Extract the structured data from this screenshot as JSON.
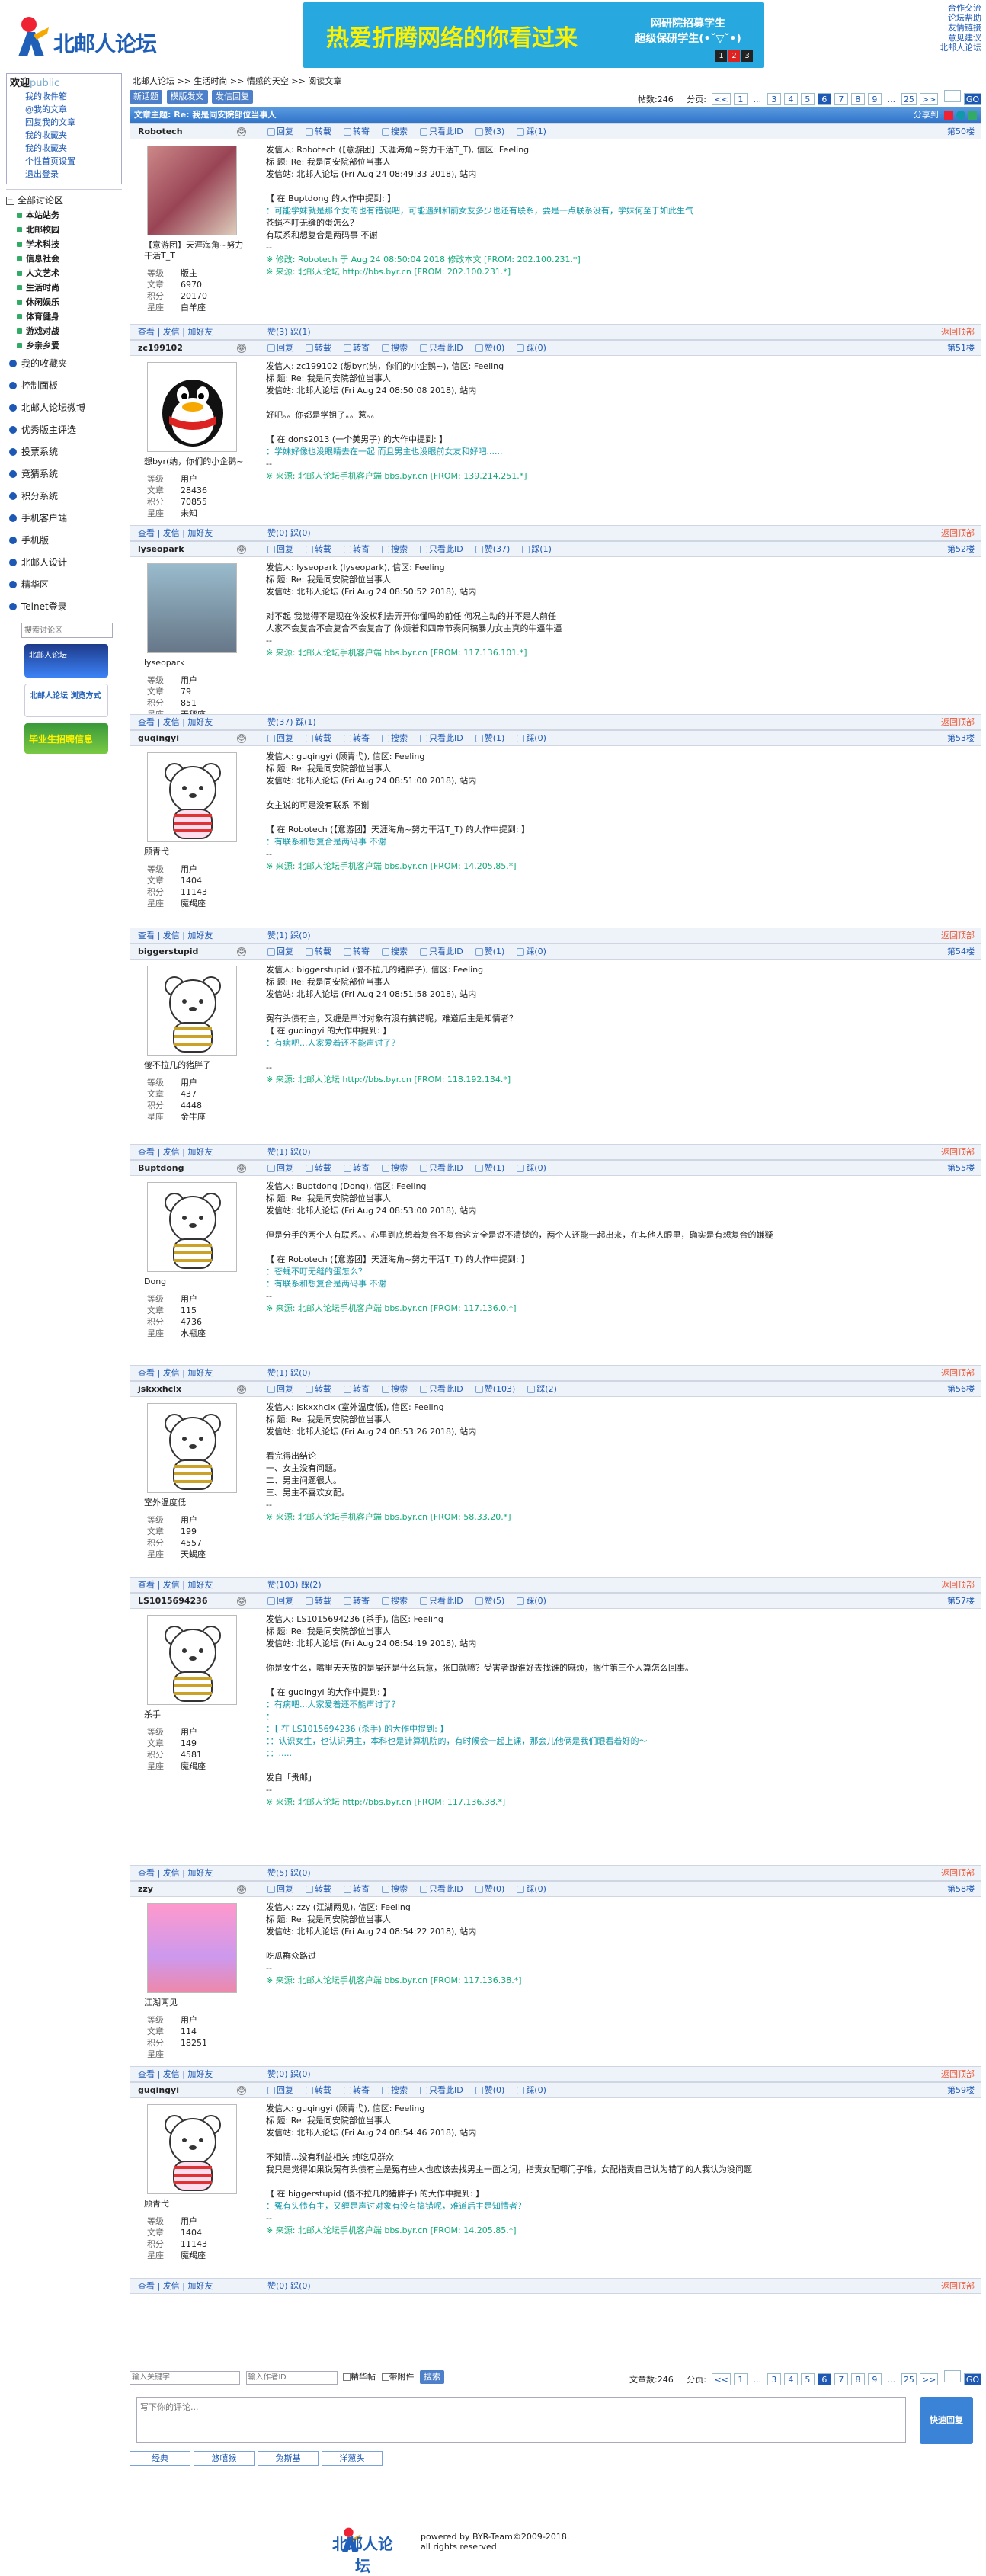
{
  "header": {
    "logo_text": "北邮人论坛",
    "banner_main": "热爱折腾网络的你看过来",
    "banner_sub1": "网研院招募学生",
    "banner_sub2": "超级保研学生(•ˇ▽ˇ•)",
    "banner_dots": [
      "1",
      "2",
      "3"
    ],
    "links": [
      "合作交流",
      "论坛帮助",
      "友情链接",
      "意见建议",
      "北邮人论坛"
    ]
  },
  "sidebar": {
    "welcome": "欢迎",
    "user": "public",
    "mine": [
      "我的收件箱",
      "@我的文章",
      "回复我的文章",
      "我的收藏夹",
      "我的收藏夹",
      "个性首页设置",
      "退出登录"
    ],
    "all_boards": "全部讨论区",
    "boards": [
      "本站站务",
      "北邮校园",
      "学术科技",
      "信息社会",
      "人文艺术",
      "生活时尚",
      "休闲娱乐",
      "体育健身",
      "游戏对战",
      "乡亲乡爱"
    ],
    "nav": [
      "我的收藏夹",
      "控制面板",
      "北邮人论坛微博",
      "优秀版主评选",
      "投票系统",
      "竞猜系统",
      "积分系统",
      "手机客户端",
      "手机版",
      "北邮人设计",
      "精华区",
      "Telnet登录"
    ],
    "search_placeholder": "搜索讨论区",
    "badge1": "北邮人论坛",
    "badge2": "北邮人论坛 浏览方式",
    "badge3": "毕业生招聘信息"
  },
  "crumb": "北邮人论坛 >> 生活时尚 >> 情感的天空 >> 阅读文章",
  "toolbar": {
    "new": "新话题",
    "mode": "模版发文",
    "reply": "发信回复",
    "count": "帖数:246",
    "pages_label": "分页:",
    "pages": [
      "<<",
      "1",
      "...",
      "3",
      "4",
      "5",
      "6",
      "7",
      "8",
      "9",
      "...",
      "25",
      ">>"
    ],
    "go": "GO"
  },
  "title": "文章主题: Re: 我是同安院部位当事人",
  "share": "分享到:",
  "acts": [
    "回复",
    "转载",
    "转寄",
    "搜索",
    "只看此ID",
    "赞(0)",
    "踩(0)"
  ],
  "posts": [
    {
      "user": "Robotech",
      "floor": "第50楼",
      "level": "版主",
      "posts": "6970",
      "score": "20170",
      "star": "白羊座",
      "sig": "【意游团】天涯海角~努力干活T_T",
      "lines": [
        "发信人: Robotech (【意游团】天涯海角~努力干活T_T), 信区: Feeling",
        "标  题: Re: 我是同安院部位当事人",
        "发信站: 北邮人论坛 (Fri Aug 24 08:49:33 2018), 站内",
        "",
        "【 在 Buptdong 的大作中提到: 】",
        "：可能学妹就是那个女的也有错误吧，可能遇到和前女友多少也还有联系，要是一点联系没有，学妹何至于如此生气",
        "苍蝇不叮无缝的蛋怎么？",
        "有联系和想复合是两码事 不谢",
        "--",
        "※ 修改: Robotech 于 Aug 24 08:50:04 2018 修改本文 [FROM: 202.100.231.*]",
        "※ 来源: 北邮人论坛 http://bbs.byr.cn [FROM: 202.100.231.*]"
      ],
      "votes": [
        "赞(3)",
        "踩(1)"
      ]
    },
    {
      "user": "zc199102",
      "floor": "第51楼",
      "level": "用户",
      "posts": "28436",
      "score": "70855",
      "star": "未知",
      "sig": "想byr(纳，你们的小企鹅~",
      "lines": [
        "发信人: zc199102 (想byr(纳，你们的小企鹅~), 信区: Feeling",
        "标  题: Re: 我是同安院部位当事人",
        "发信站: 北邮人论坛 (Fri Aug 24 08:50:08 2018), 站内",
        "",
        "好吧。。你都是学姐了。。惹。。",
        "",
        "【 在 dons2013 (一个美男子) 的大作中提到: 】",
        "：学妹好像也没眼睛去在一起 而且男主也没眼前女友和好吧......",
        "--",
        "※ 来源: 北邮人论坛手机客户端 bbs.byr.cn [FROM: 139.214.251.*]"
      ],
      "votes": [
        "赞(0)",
        "踩(0)"
      ]
    },
    {
      "user": "lyseopark",
      "floor": "第52楼",
      "level": "用户",
      "posts": "79",
      "score": "851",
      "star": "天秤座",
      "sig": "lyseopark",
      "lines": [
        "发信人: lyseopark (lyseopark), 信区: Feeling",
        "标  题: Re: 我是同安院部位当事人",
        "发信站: 北邮人论坛 (Fri Aug 24 08:50:52 2018), 站内",
        "",
        "对不起 我觉得不是现在你没权利去弄开你懂吗的前任 何况主动的并不是人前任",
        "人家不会复合不会复合不会复合了 你烦着和四帝节奏同稿暴力女主真的牛逼牛逼",
        "--",
        "※ 来源: 北邮人论坛手机客户端 bbs.byr.cn [FROM: 117.136.101.*]"
      ],
      "votes": [
        "赞(37)",
        "踩(1)"
      ]
    },
    {
      "user": "guqingyi",
      "floor": "第53楼",
      "level": "用户",
      "posts": "1404",
      "score": "11143",
      "star": "魔羯座",
      "sig": "顾青弋",
      "lines": [
        "发信人: guqingyi (顾青弋), 信区: Feeling",
        "标  题: Re: 我是同安院部位当事人",
        "发信站: 北邮人论坛 (Fri Aug 24 08:51:00 2018), 站内",
        "",
        "女主说的可是没有联系 不谢",
        "",
        "【 在 Robotech (【意游团】天涯海角~努力干活T_T) 的大作中提到: 】",
        "：有联系和想复合是两码事 不谢",
        "--",
        "※ 来源: 北邮人论坛手机客户端 bbs.byr.cn [FROM: 14.205.85.*]"
      ],
      "votes": [
        "赞(1)",
        "踩(0)"
      ]
    },
    {
      "user": "biggerstupid",
      "floor": "第54楼",
      "level": "用户",
      "posts": "437",
      "score": "4448",
      "star": "金牛座",
      "sig": "傻不拉几的猪胖子",
      "lines": [
        "发信人: biggerstupid (傻不拉几的猪胖子), 信区: Feeling",
        "标  题: Re: 我是同安院部位当事人",
        "发信站: 北邮人论坛 (Fri Aug 24 08:51:58 2018), 站内",
        "",
        "冤有头债有主，又缠是声讨对象有没有搞错呢，难道后主是知情者？",
        "【 在 guqingyi 的大作中提到: 】",
        "：有病吧...人家爱着还不能声讨了？",
        "",
        "--",
        "※ 来源: 北邮人论坛 http://bbs.byr.cn [FROM: 118.192.134.*]"
      ],
      "votes": [
        "赞(1)",
        "踩(0)"
      ]
    },
    {
      "user": "Buptdong",
      "floor": "第55楼",
      "level": "用户",
      "posts": "115",
      "score": "4736",
      "star": "水瓶座",
      "sig": "Dong",
      "lines": [
        "发信人: Buptdong (Dong), 信区: Feeling",
        "标  题: Re: 我是同安院部位当事人",
        "发信站: 北邮人论坛 (Fri Aug 24 08:53:00 2018), 站内",
        "",
        "但是分手的两个人有联系。。心里到底想着复合不复合这完全是说不清楚的，两个人还能一起出来，在其他人眼里，确实是有想复合的嫌疑",
        "",
        "【 在 Robotech (【意游团】天涯海角~努力干活T_T) 的大作中提到: 】",
        "：苍蝇不叮无缝的蛋怎么？",
        "：有联系和想复合是两码事 不谢",
        "--",
        "※ 来源: 北邮人论坛手机客户端 bbs.byr.cn [FROM: 117.136.0.*]"
      ],
      "votes": [
        "赞(1)",
        "踩(0)"
      ]
    },
    {
      "user": "jskxxhclx",
      "floor": "第56楼",
      "level": "用户",
      "posts": "199",
      "score": "4557",
      "star": "天蝎座",
      "sig": "室外温度低",
      "lines": [
        "发信人: jskxxhclx (室外温度低), 信区: Feeling",
        "标  题: Re: 我是同安院部位当事人",
        "发信站: 北邮人论坛 (Fri Aug 24 08:53:26 2018), 站内",
        "",
        "看完得出结论",
        "一、女主没有问题。",
        "二、男主问题很大。",
        "三、男主不喜欢女配。",
        "--",
        "※ 来源: 北邮人论坛手机客户端 bbs.byr.cn [FROM: 58.33.20.*]"
      ],
      "votes": [
        "赞(103)",
        "踩(2)"
      ]
    },
    {
      "user": "LS1015694236",
      "floor": "第57楼",
      "level": "用户",
      "posts": "149",
      "score": "4581",
      "star": "魔羯座",
      "sig": "杀手",
      "lines": [
        "发信人: LS1015694236 (杀手), 信区: Feeling",
        "标  题: Re: 我是同安院部位当事人",
        "发信站: 北邮人论坛 (Fri Aug 24 08:54:19 2018), 站内",
        "",
        "你是女生么，嘴里天天放的是屎还是什么玩意，张口就喷？受害者跟谁好去找谁的麻烦，搁住第三个人算怎么回事。",
        "",
        "【 在 guqingyi 的大作中提到: 】",
        "：有病吧...人家爱着还不能声讨了？",
        "：",
        "：【 在 LS1015694236 (杀手) 的大作中提到: 】",
        "：：认识女生，也认识男主，本科也是计算机院的，有时候会一起上课，那会儿他俩是我们眼看着好的～",
        "：：.....",
        "",
        "发自「贵邮」",
        "--",
        "※ 来源: 北邮人论坛 http://bbs.byr.cn [FROM: 117.136.38.*]"
      ],
      "votes": [
        "赞(5)",
        "踩(0)"
      ]
    },
    {
      "user": "zzy",
      "floor": "第58楼",
      "level": "用户",
      "posts": "114",
      "score": "18251",
      "star": "",
      "sig": "江湖两见",
      "lines": [
        "发信人: zzy (江湖两见), 信区: Feeling",
        "标  题: Re: 我是同安院部位当事人",
        "发信站: 北邮人论坛 (Fri Aug 24 08:54:22 2018), 站内",
        "",
        "吃瓜群众路过",
        "--",
        "※ 来源: 北邮人论坛手机客户端 bbs.byr.cn [FROM: 117.136.38.*]"
      ],
      "votes": [
        "赞(0)",
        "踩(0)"
      ]
    },
    {
      "user": "guqingyi",
      "floor": "第59楼",
      "level": "用户",
      "posts": "1404",
      "score": "11143",
      "star": "魔羯座",
      "sig": "顾青弋",
      "lines": [
        "发信人: guqingyi (顾青弋), 信区: Feeling",
        "标  题: Re: 我是同安院部位当事人",
        "发信站: 北邮人论坛 (Fri Aug 24 08:54:46 2018), 站内",
        "",
        "不知情...没有利益相关 纯吃瓜群众",
        "我只是觉得如果说冤有头债有主是冤有些人也应该去找男主一面之词，指责女配哪门子唯，女配指责自己认为错了的人我认为没问题",
        "",
        "【 在 biggerstupid (傻不拉几的猪胖子) 的大作中提到: 】",
        "：冤有头债有主，又缠是声讨对象有没有搞错呢，难道后主是知情者？",
        "--",
        "※ 来源: 北邮人论坛手机客户端 bbs.byr.cn [FROM: 14.205.85.*]"
      ],
      "votes": [
        "赞(0)",
        "踩(0)"
      ]
    }
  ],
  "foot_acts": [
    "查看",
    "发信",
    "加好友"
  ],
  "back_top": "返回顶部",
  "bottom": {
    "search_ph": "输入关键字",
    "author_ph": "输入作者ID",
    "elite": "精华帖",
    "attach": "带附件",
    "search_btn": "搜索",
    "count": "文章数:246",
    "reply_ph": "写下你的评论...",
    "quick": "快速回复",
    "tabs": [
      "经典",
      "悠嘻猴",
      "兔斯基",
      "洋葱头"
    ]
  },
  "footer": {
    "logo": "北邮人论坛",
    "line1": "powered by BYR-Team©2009-2018.",
    "line2": "all rights reserved"
  }
}
